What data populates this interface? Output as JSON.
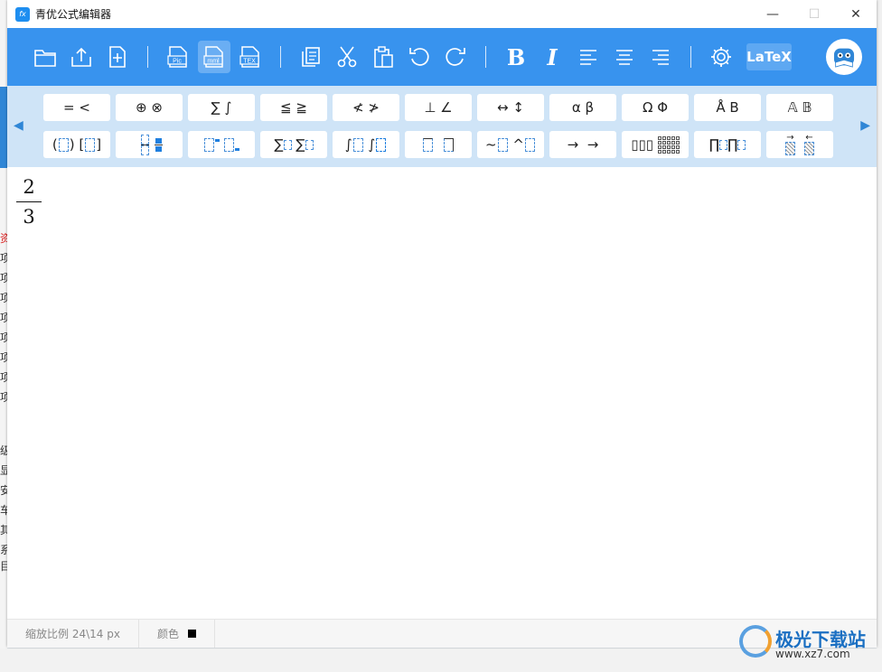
{
  "window": {
    "title": "青优公式编辑器",
    "app_icon_text": "fx",
    "minimize": "—",
    "maximize": "☐",
    "close": "✕"
  },
  "toolbar": {
    "latex_label": "LaTeX",
    "pic_label": "Pic",
    "mml_label": "mml",
    "tex_label": "TEX",
    "bold_label": "B",
    "italic_label": "I"
  },
  "palette": {
    "row1": [
      "= <",
      "⊕ ⊗",
      "∑ ∫",
      "≦ ≧",
      "≮ ≯",
      "⊥ ∠",
      "↔ ↕",
      "α β",
      "Ω Φ",
      "Å B",
      "𝔸 𝔹"
    ],
    "row2_names": [
      "fence-templates",
      "fraction-templates",
      "script-templates",
      "sum-templates",
      "integral-templates",
      "bar-templates",
      "accent-templates",
      "arrow-templates",
      "matrix-templates",
      "product-templates",
      "vector-templates"
    ]
  },
  "editor": {
    "numerator": "2",
    "denominator": "3"
  },
  "status": {
    "zoom": "缩放比例 24\\14 px",
    "color_label": "颜色"
  },
  "watermark": {
    "title": "极光下载站",
    "url": "www.xz7.com"
  },
  "background": {
    "chars": [
      "资",
      "项",
      "项",
      "项",
      "项",
      "项",
      "项",
      "项",
      "项",
      "级",
      "显",
      "安",
      "车",
      "其",
      "系",
      "目"
    ]
  },
  "colors": {
    "toolbar": "#3893ee",
    "palette": "#cfe4f7",
    "accent": "#1f7fdf"
  }
}
